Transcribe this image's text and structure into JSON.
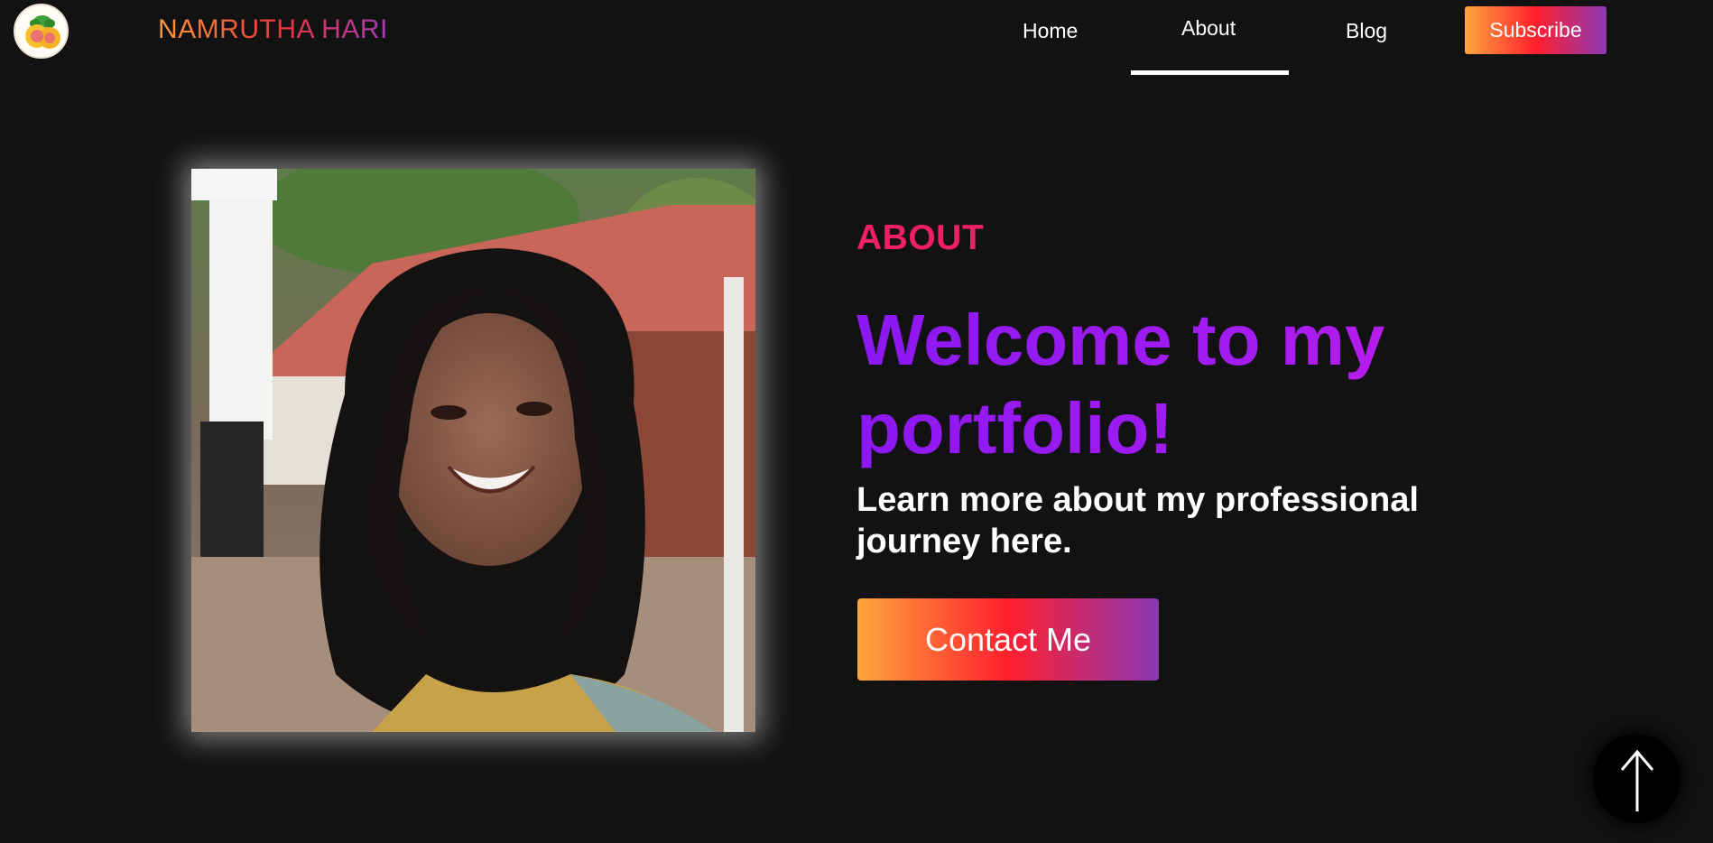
{
  "header": {
    "brand": "NAMRUTHA HARI",
    "nav": {
      "home": "Home",
      "about": "About",
      "blog": "Blog"
    },
    "active_nav": "About",
    "subscribe_label": "Subscribe",
    "logo_icon": "fruit-logo-icon"
  },
  "main": {
    "kicker": "ABOUT",
    "title": "Welcome to my portfolio!",
    "subtitle": "Learn more about my professional journey here.",
    "contact_label": "Contact Me",
    "portrait_alt": "portrait-photo"
  },
  "back_to_top_icon": "arrow-up-icon",
  "colors": {
    "background": "#121212",
    "accent_pink": "#ef1f68",
    "accent_purple": "#a31cf2",
    "gradient_start": "#ffa63c",
    "gradient_mid": "#ff1f2d",
    "gradient_end": "#8b39b5"
  }
}
